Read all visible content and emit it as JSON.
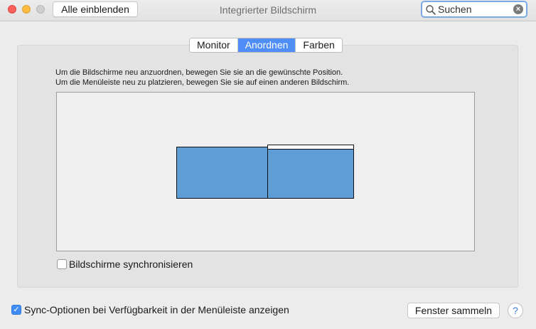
{
  "window": {
    "title": "Integrierter Bildschirm",
    "show_all_label": "Alle einblenden"
  },
  "search": {
    "placeholder": "Suchen",
    "value": ""
  },
  "tabs": [
    {
      "label": "Monitor",
      "active": false
    },
    {
      "label": "Anordnen",
      "active": true
    },
    {
      "label": "Farben",
      "active": false
    }
  ],
  "arrange": {
    "instruction_1": "Um die Bildschirme neu anzuordnen, bewegen Sie sie an die gewünschte Position.",
    "instruction_2": "Um die Menüleiste neu zu platzieren, bewegen Sie sie auf einen anderen Bildschirm.",
    "display_color": "#5e9dd5"
  },
  "mirror_displays": {
    "label": "Bildschirme synchronisieren",
    "checked": false
  },
  "show_sync_options": {
    "label": "Sync-Optionen bei Verfügbarkeit in der Menüleiste anzeigen",
    "checked": true
  },
  "footer": {
    "gather_windows_label": "Fenster sammeln",
    "help_label": "?"
  },
  "colors": {
    "accent": "#4f8df7",
    "close": "#fc605c",
    "minimize": "#fdbc40"
  }
}
